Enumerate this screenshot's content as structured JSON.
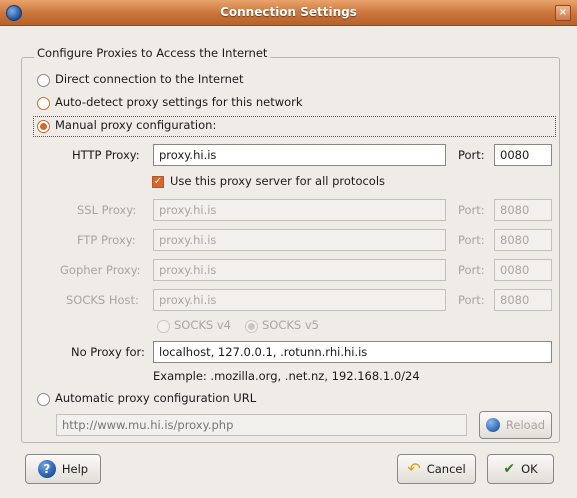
{
  "window": {
    "title": "Connection Settings",
    "close_glyph": "×",
    "icon": "app-globe-icon"
  },
  "group": {
    "title": "Configure Proxies to Access the Internet"
  },
  "options": {
    "direct": {
      "label": "Direct connection to the Internet",
      "checked": false
    },
    "auto_detect": {
      "label": "Auto-detect proxy settings for this network",
      "checked": false
    },
    "manual": {
      "label": "Manual proxy configuration:",
      "checked": true
    },
    "pac": {
      "label": "Automatic proxy configuration URL",
      "checked": false
    }
  },
  "manual": {
    "http": {
      "label": "HTTP Proxy:",
      "value": "proxy.hi.is",
      "port_label": "Port:",
      "port": "0080"
    },
    "share_all": {
      "label": "Use this proxy server for all protocols",
      "checked": true
    },
    "ssl": {
      "label": "SSL Proxy:",
      "value": "proxy.hi.is",
      "port_label": "Port:",
      "port": "8080"
    },
    "ftp": {
      "label": "FTP Proxy:",
      "value": "proxy.hi.is",
      "port_label": "Port:",
      "port": "8080"
    },
    "gopher": {
      "label": "Gopher Proxy:",
      "value": "proxy.hi.is",
      "port_label": "Port:",
      "port": "0080"
    },
    "socks": {
      "label": "SOCKS Host:",
      "value": "proxy.hi.is",
      "port_label": "Port:",
      "port": "8080"
    },
    "socks_v4": {
      "label": "SOCKS v4",
      "checked": false
    },
    "socks_v5": {
      "label": "SOCKS v5",
      "checked": true
    },
    "no_proxy": {
      "label": "No Proxy for:",
      "value": "localhost, 127.0.0.1, .rotunn.rhi.hi.is"
    },
    "example": "Example: .mozilla.org, .net.nz, 192.168.1.0/24"
  },
  "pac": {
    "placeholder": "http://www.mu.hi.is/proxy.php",
    "reload_label": "Reload"
  },
  "buttons": {
    "help": "Help",
    "cancel": "Cancel",
    "ok": "OK"
  }
}
